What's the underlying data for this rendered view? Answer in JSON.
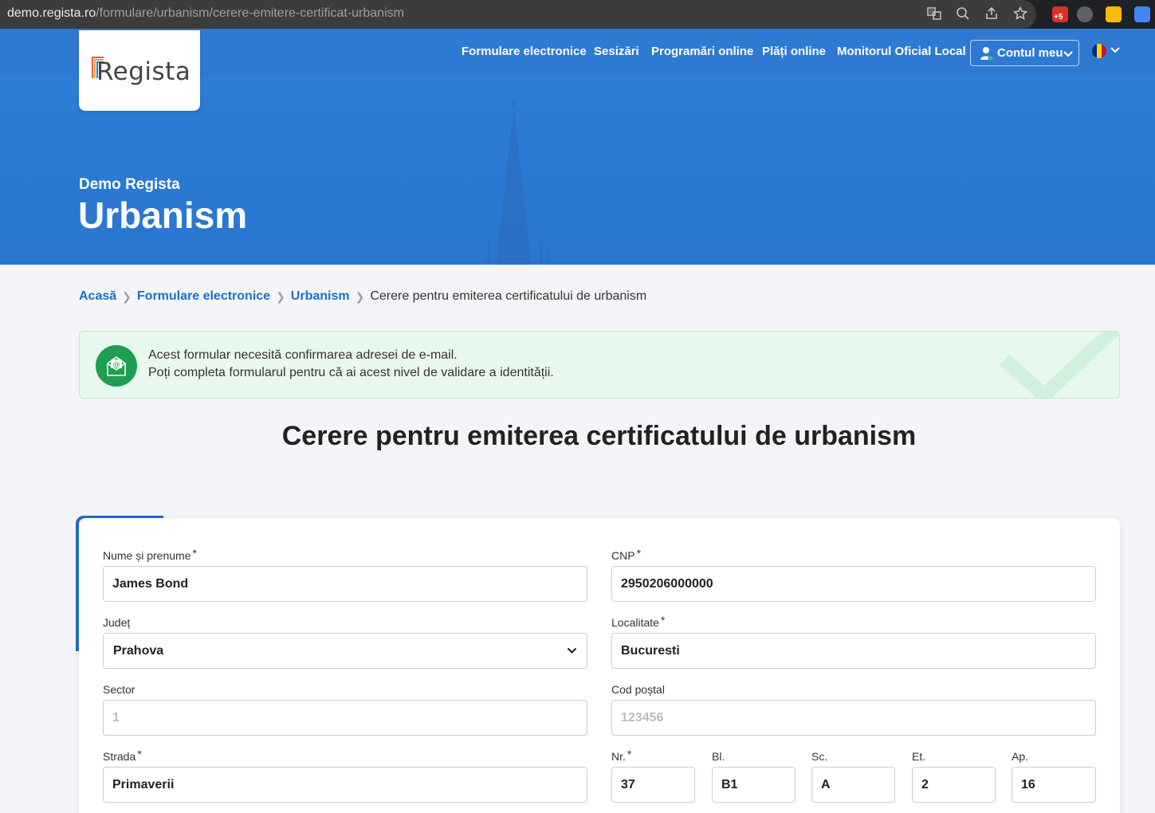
{
  "browser": {
    "url_host": "demo.regista.ro",
    "url_path": "/formulare/urbanism/cerere-emitere-certificat-urbanism",
    "extension_badge": "+5"
  },
  "header": {
    "logo_text": "Regista",
    "nav": [
      "Formulare electronice",
      "Sesizări",
      "Programări online",
      "Plăți online",
      "Monitorul Oficial Local"
    ],
    "account_label": "Contul meu",
    "language": "RO"
  },
  "hero": {
    "subtitle": "Demo Regista",
    "title": "Urbanism"
  },
  "breadcrumb": {
    "items": [
      "Acasă",
      "Formulare electronice",
      "Urbanism"
    ],
    "current": "Cerere pentru emiterea certificatului de urbanism"
  },
  "notice": {
    "line1": "Acest formular necesită confirmarea adresei de e-mail.",
    "line2": "Poți completa formularul pentru că ai acest nivel de validare a identității."
  },
  "page_title": "Cerere pentru emiterea certificatului de urbanism",
  "form": {
    "name": {
      "label": "Nume și prenume",
      "value": "James Bond"
    },
    "cnp": {
      "label": "CNP",
      "value": "2950206000000"
    },
    "county": {
      "label": "Județ",
      "value": "Prahova"
    },
    "locality": {
      "label": "Localitate",
      "value": "Bucuresti"
    },
    "sector": {
      "label": "Sector",
      "placeholder": "1"
    },
    "postal": {
      "label": "Cod poștal",
      "placeholder": "123456"
    },
    "street": {
      "label": "Strada",
      "value": "Primaverii"
    },
    "nr": {
      "label": "Nr.",
      "value": "37"
    },
    "bl": {
      "label": "Bl.",
      "value": "B1"
    },
    "sc": {
      "label": "Sc.",
      "value": "A"
    },
    "et": {
      "label": "Et.",
      "value": "2"
    },
    "ap": {
      "label": "Ap.",
      "value": "16"
    },
    "required_mark": "*"
  },
  "colors": {
    "primary": "#2e7ad3",
    "link": "#1e6fc8",
    "success": "#1e9e52"
  }
}
